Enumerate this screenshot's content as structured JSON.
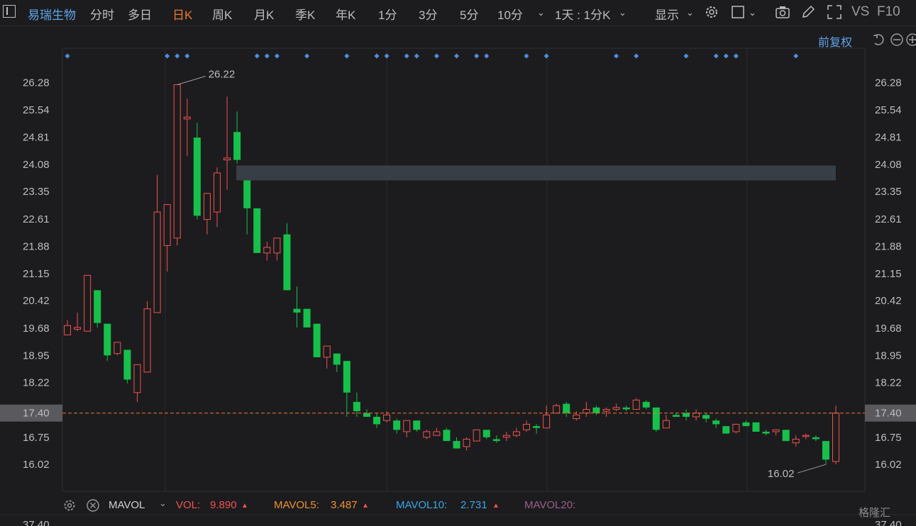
{
  "toolbar": {
    "stock_name": "易瑞生物",
    "tabs": [
      "分时",
      "多日",
      "日K",
      "周K",
      "月K",
      "季K",
      "年K",
      "1分",
      "3分",
      "5分",
      "10分"
    ],
    "active_tab": "日K",
    "period_select": "1天 : 1分K",
    "display_label": "显示",
    "vs_label": "VS",
    "f10_label": "F10"
  },
  "subbar": {
    "fuquan_label": "前复权"
  },
  "volume_indicator": {
    "name": "MAVOL",
    "vol_label": "VOL:",
    "vol_value": "9.890",
    "mavol5_label": "MAVOL5:",
    "mavol5_value": "3.487",
    "mavol10_label": "MAVOL10:",
    "mavol10_value": "2.731",
    "mavol20_label": "MAVOL20:"
  },
  "watermark": "格隆汇",
  "colors": {
    "up": "#f0524f",
    "down": "#16c04b",
    "accent": "#f0772f",
    "link": "#5fa4e8"
  },
  "chart_data": {
    "type": "candlestick",
    "y_ticks": [
      "26.28",
      "25.54",
      "24.81",
      "24.08",
      "23.35",
      "22.61",
      "21.88",
      "21.15",
      "20.42",
      "19.68",
      "18.95",
      "18.22",
      "17.40",
      "16.75",
      "16.02"
    ],
    "ylim": [
      15.3,
      27.2
    ],
    "current_price": "17.40",
    "bottom_axis_label": "37.40",
    "annotations": [
      {
        "label": "26.22",
        "type": "high"
      },
      {
        "label": "16.02",
        "type": "low"
      }
    ],
    "resistance_zone": [
      23.65,
      24.05
    ],
    "candles": [
      [
        19.5,
        19.75,
        19.5,
        19.9
      ],
      [
        19.65,
        19.7,
        19.6,
        20.1
      ],
      [
        19.6,
        21.1,
        19.6,
        21.1
      ],
      [
        20.7,
        19.82,
        19.7,
        20.7
      ],
      [
        19.8,
        18.95,
        18.8,
        19.8
      ],
      [
        19.0,
        19.3,
        18.95,
        19.3
      ],
      [
        19.1,
        18.3,
        18.2,
        19.1
      ],
      [
        17.95,
        18.7,
        17.7,
        18.7
      ],
      [
        18.5,
        20.2,
        18.5,
        20.4
      ],
      [
        20.1,
        22.8,
        20.1,
        23.8
      ],
      [
        21.9,
        23.0,
        21.2,
        23.0
      ],
      [
        22.1,
        26.22,
        21.9,
        26.22
      ],
      [
        25.3,
        25.35,
        24.3,
        25.85
      ],
      [
        24.8,
        22.7,
        22.6,
        25.2
      ],
      [
        22.6,
        23.3,
        22.2,
        23.3
      ],
      [
        22.8,
        23.85,
        22.4,
        24.0
      ],
      [
        24.2,
        24.25,
        23.4,
        25.9
      ],
      [
        24.95,
        24.2,
        24.1,
        25.5
      ],
      [
        23.65,
        22.9,
        22.2,
        23.65
      ],
      [
        22.9,
        21.7,
        21.7,
        22.9
      ],
      [
        21.7,
        21.85,
        21.5,
        22.0
      ],
      [
        21.7,
        22.1,
        21.5,
        22.1
      ],
      [
        22.2,
        20.7,
        20.7,
        22.5
      ],
      [
        20.2,
        20.1,
        19.7,
        20.8
      ],
      [
        20.2,
        19.7,
        19.7,
        20.2
      ],
      [
        19.8,
        18.9,
        18.9,
        19.8
      ],
      [
        18.9,
        19.2,
        18.6,
        19.2
      ],
      [
        19.0,
        18.7,
        18.5,
        19.0
      ],
      [
        18.8,
        17.95,
        17.3,
        18.8
      ],
      [
        17.7,
        17.45,
        17.3,
        17.95
      ],
      [
        17.4,
        17.3,
        17.3,
        17.5
      ],
      [
        17.3,
        17.1,
        17.0,
        17.4
      ],
      [
        17.2,
        17.35,
        17.15,
        17.45
      ],
      [
        17.2,
        16.95,
        16.85,
        17.25
      ],
      [
        16.9,
        17.2,
        16.75,
        17.2
      ],
      [
        17.2,
        16.95,
        16.9,
        17.2
      ],
      [
        16.75,
        16.9,
        16.7,
        16.95
      ],
      [
        16.8,
        16.9,
        16.8,
        17.0
      ],
      [
        16.95,
        16.65,
        16.65,
        17.0
      ],
      [
        16.65,
        16.45,
        16.45,
        16.75
      ],
      [
        16.5,
        16.7,
        16.4,
        16.75
      ],
      [
        16.65,
        16.95,
        16.65,
        16.95
      ],
      [
        16.95,
        16.75,
        16.7,
        16.95
      ],
      [
        16.7,
        16.65,
        16.6,
        16.8
      ],
      [
        16.75,
        16.8,
        16.65,
        16.9
      ],
      [
        16.8,
        16.9,
        16.75,
        17.0
      ],
      [
        16.95,
        17.1,
        16.9,
        17.2
      ],
      [
        17.05,
        17.0,
        16.85,
        17.1
      ],
      [
        17.0,
        17.35,
        17.0,
        17.6
      ],
      [
        17.4,
        17.6,
        17.4,
        17.65
      ],
      [
        17.65,
        17.4,
        17.3,
        17.7
      ],
      [
        17.25,
        17.35,
        17.2,
        17.45
      ],
      [
        17.4,
        17.5,
        17.3,
        17.7
      ],
      [
        17.55,
        17.4,
        17.35,
        17.6
      ],
      [
        17.45,
        17.5,
        17.3,
        17.55
      ],
      [
        17.5,
        17.55,
        17.45,
        17.65
      ],
      [
        17.55,
        17.5,
        17.45,
        17.6
      ],
      [
        17.5,
        17.75,
        17.5,
        17.8
      ],
      [
        17.7,
        17.55,
        17.5,
        17.75
      ],
      [
        17.55,
        16.95,
        16.9,
        17.55
      ],
      [
        17.0,
        17.2,
        17.0,
        17.35
      ],
      [
        17.35,
        17.3,
        17.3,
        17.4
      ],
      [
        17.4,
        17.3,
        17.2,
        17.5
      ],
      [
        17.3,
        17.4,
        17.2,
        17.5
      ],
      [
        17.35,
        17.25,
        17.15,
        17.4
      ],
      [
        17.2,
        17.1,
        17.0,
        17.25
      ],
      [
        17.05,
        16.85,
        16.85,
        17.05
      ],
      [
        16.9,
        17.1,
        16.85,
        17.1
      ],
      [
        17.15,
        17.05,
        17.05,
        17.2
      ],
      [
        17.15,
        16.9,
        16.9,
        17.15
      ],
      [
        16.9,
        16.85,
        16.8,
        16.95
      ],
      [
        16.9,
        16.95,
        16.8,
        16.95
      ],
      [
        16.95,
        16.65,
        16.65,
        16.95
      ],
      [
        16.6,
        16.7,
        16.5,
        16.8
      ],
      [
        16.8,
        16.8,
        16.7,
        16.85
      ],
      [
        16.75,
        16.7,
        16.65,
        16.8
      ],
      [
        16.65,
        16.15,
        16.02,
        16.65
      ],
      [
        16.1,
        17.4,
        16.02,
        17.6
      ]
    ],
    "marker_days": [
      0,
      10,
      11,
      12,
      19,
      20,
      21,
      24,
      28,
      31,
      32,
      34,
      35,
      37,
      39,
      41,
      42,
      46,
      48,
      55,
      57,
      62,
      65,
      66,
      67,
      73
    ]
  }
}
